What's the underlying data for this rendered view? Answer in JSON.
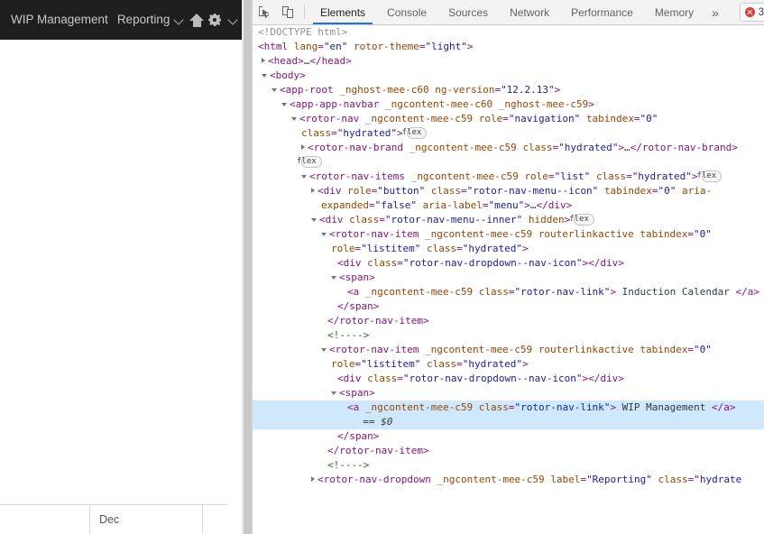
{
  "webpage": {
    "navbar": {
      "links": [
        {
          "label": "WIP Management",
          "name": "nav-link-wip-management"
        }
      ],
      "dropdown": {
        "label": "Reporting",
        "name": "nav-dropdown-reporting"
      },
      "icons": [
        {
          "name": "home-icon"
        },
        {
          "name": "gear-icon"
        },
        {
          "name": "chevron-down-icon"
        }
      ],
      "background": "#1e1e1e",
      "text_color": "#c9c9c9"
    },
    "bottom_table": {
      "cells": [
        "",
        "Dec",
        ""
      ]
    }
  },
  "devtools": {
    "toolbar": {
      "inspect_icon": "inspect-element-icon",
      "device_icon": "device-toolbar-icon",
      "tabs": [
        {
          "label": "Elements",
          "active": true
        },
        {
          "label": "Console",
          "active": false
        },
        {
          "label": "Sources",
          "active": false
        },
        {
          "label": "Network",
          "active": false
        },
        {
          "label": "Performance",
          "active": false
        },
        {
          "label": "Memory",
          "active": false
        }
      ],
      "more_label": "»",
      "error_count": "3",
      "accent_color": "#1a73e8",
      "error_color": "#e53935"
    },
    "dom_tree": {
      "lines": [
        {
          "indent": 0,
          "twisty": "none",
          "html": "<span class=\"doct\">&lt;!DOCTYPE html&gt;</span>"
        },
        {
          "indent": 0,
          "twisty": "none",
          "html": "<span class=\"punc\">&lt;</span><span class=\"tag\">html</span> <span class=\"attr\">lang</span><span class=\"punc\">=</span><span class=\"val\">\"en\"</span> <span class=\"attr\">rotor-theme</span><span class=\"punc\">=</span><span class=\"val\">\"light\"</span><span class=\"punc\">&gt;</span>"
        },
        {
          "indent": 1,
          "twisty": "closed",
          "html": "<span class=\"punc\">&lt;</span><span class=\"tag\">head</span><span class=\"punc\">&gt;</span><span class=\"txt\">…</span><span class=\"punc\">&lt;/</span><span class=\"tag\">head</span><span class=\"punc\">&gt;</span>"
        },
        {
          "indent": 1,
          "twisty": "open",
          "html": "<span class=\"punc\">&lt;</span><span class=\"tag\">body</span><span class=\"punc\">&gt;</span>"
        },
        {
          "indent": 2,
          "twisty": "open",
          "html": "<span class=\"punc\">&lt;</span><span class=\"tag\">app-root</span> <span class=\"attr\">_nghost-mee-c60</span> <span class=\"attr\">ng-version</span><span class=\"punc\">=</span><span class=\"val\">\"12.2.13\"</span><span class=\"punc\">&gt;</span>"
        },
        {
          "indent": 3,
          "twisty": "open",
          "html": "<span class=\"punc\">&lt;</span><span class=\"tag\">app-app-navbar</span> <span class=\"attr\">_ngcontent-mee-c60</span> <span class=\"attr\">_nghost-mee-c59</span><span class=\"punc\">&gt;</span>"
        },
        {
          "indent": 4,
          "twisty": "open",
          "html": "<span class=\"punc\">&lt;</span><span class=\"tag\">rotor-nav</span> <span class=\"attr\">_ngcontent-mee-c59</span> <span class=\"attr\">role</span><span class=\"punc\">=</span><span class=\"val\">\"navigation\"</span> <span class=\"attr\">tabindex</span><span class=\"punc\">=</span><span class=\"val\">\"0\"</span> <span class=\"attr\">class</span><span class=\"punc\">=</span><span class=\"val\">\"hydrated\"</span><span class=\"punc\">&gt;</span><span class=\"badge\">flex</span>"
        },
        {
          "indent": 5,
          "twisty": "closed",
          "html": "<span class=\"punc\">&lt;</span><span class=\"tag\">rotor-nav-brand</span> <span class=\"attr\">_ngcontent-mee-c59</span> <span class=\"attr\">class</span><span class=\"punc\">=</span><span class=\"val\">\"hydrated\"</span><span class=\"punc\">&gt;</span><span class=\"txt\">…</span><span class=\"punc\">&lt;/</span><span class=\"tag\">rotor-nav-brand</span><span class=\"punc\">&gt;</span>"
        },
        {
          "indent": 5,
          "twisty": "blank",
          "html": "<span class=\"badge\" style=\"margin-left:0\">flex</span>"
        },
        {
          "indent": 5,
          "twisty": "open",
          "html": "<span class=\"punc\">&lt;</span><span class=\"tag\">rotor-nav-items</span> <span class=\"attr\">_ngcontent-mee-c59</span> <span class=\"attr\">role</span><span class=\"punc\">=</span><span class=\"val\">\"list\"</span> <span class=\"attr\">class</span><span class=\"punc\">=</span><span class=\"val\">\"hydrated\"</span><span class=\"punc\">&gt;</span><span class=\"badge\">flex</span>"
        },
        {
          "indent": 6,
          "twisty": "closed",
          "html": "<span class=\"punc\">&lt;</span><span class=\"tag\">div</span> <span class=\"attr\">role</span><span class=\"punc\">=</span><span class=\"val\">\"button\"</span> <span class=\"attr\">class</span><span class=\"punc\">=</span><span class=\"val\">\"rotor-nav-menu--icon\"</span> <span class=\"attr\">tabindex</span><span class=\"punc\">=</span><span class=\"val\">\"0\"</span> <span class=\"attr\">aria-expanded</span><span class=\"punc\">=</span><span class=\"val\">\"false\"</span> <span class=\"attr\">aria-label</span><span class=\"punc\">=</span><span class=\"val\">\"menu\"</span><span class=\"punc\">&gt;</span><span class=\"txt\">…</span><span class=\"punc\">&lt;/</span><span class=\"tag\">div</span><span class=\"punc\">&gt;</span>"
        },
        {
          "indent": 6,
          "twisty": "open",
          "html": "<span class=\"punc\">&lt;</span><span class=\"tag\">div</span> <span class=\"attr\">class</span><span class=\"punc\">=</span><span class=\"val\">\"rotor-nav-menu--inner\"</span> <span class=\"attr\">hidden</span><span class=\"punc\">&gt;</span><span class=\"badge\">flex</span>"
        },
        {
          "indent": 7,
          "twisty": "open",
          "html": "<span class=\"punc\">&lt;</span><span class=\"tag\">rotor-nav-item</span> <span class=\"attr\">_ngcontent-mee-c59</span> <span class=\"attr\">routerlinkactive</span> <span class=\"attr\">tabindex</span><span class=\"punc\">=</span><span class=\"val\">\"0\"</span> <span class=\"attr\">role</span><span class=\"punc\">=</span><span class=\"val\">\"listitem\"</span> <span class=\"attr\">class</span><span class=\"punc\">=</span><span class=\"val\">\"hydrated\"</span><span class=\"punc\">&gt;</span>"
        },
        {
          "indent": 8,
          "twisty": "none",
          "html": "<span class=\"punc\">&lt;</span><span class=\"tag\">div</span> <span class=\"attr\">class</span><span class=\"punc\">=</span><span class=\"val\">\"rotor-nav-dropdown--nav-icon\"</span><span class=\"punc\">&gt;&lt;/</span><span class=\"tag\">div</span><span class=\"punc\">&gt;</span>"
        },
        {
          "indent": 8,
          "twisty": "open",
          "html": "<span class=\"punc\">&lt;</span><span class=\"tag\">span</span><span class=\"punc\">&gt;</span>"
        },
        {
          "indent": 9,
          "twisty": "none",
          "html": "<span class=\"punc\">&lt;</span><span class=\"tag\">a</span> <span class=\"attr\">_ngcontent-mee-c59</span> <span class=\"attr\">class</span><span class=\"punc\">=</span><span class=\"val\">\"rotor-nav-link\"</span><span class=\"punc\">&gt;</span><span class=\"txt\"> Induction Calendar </span><span class=\"punc\">&lt;/</span><span class=\"tag\">a</span><span class=\"punc\">&gt;</span>"
        },
        {
          "indent": 8,
          "twisty": "none",
          "html": "<span class=\"punc\">&lt;/</span><span class=\"tag\">span</span><span class=\"punc\">&gt;</span>"
        },
        {
          "indent": 7,
          "twisty": "none",
          "html": "<span class=\"punc\">&lt;/</span><span class=\"tag\">rotor-nav-item</span><span class=\"punc\">&gt;</span>"
        },
        {
          "indent": 7,
          "twisty": "none",
          "html": "<span class=\"cmt\">&lt;!----&gt;</span>"
        },
        {
          "indent": 7,
          "twisty": "open",
          "html": "<span class=\"punc\">&lt;</span><span class=\"tag\">rotor-nav-item</span> <span class=\"attr\">_ngcontent-mee-c59</span> <span class=\"attr\">routerlinkactive</span> <span class=\"attr\">tabindex</span><span class=\"punc\">=</span><span class=\"val\">\"0\"</span> <span class=\"attr\">role</span><span class=\"punc\">=</span><span class=\"val\">\"listitem\"</span> <span class=\"attr\">class</span><span class=\"punc\">=</span><span class=\"val\">\"hydrated\"</span><span class=\"punc\">&gt;</span>"
        },
        {
          "indent": 8,
          "twisty": "none",
          "html": "<span class=\"punc\">&lt;</span><span class=\"tag\">div</span> <span class=\"attr\">class</span><span class=\"punc\">=</span><span class=\"val\">\"rotor-nav-dropdown--nav-icon\"</span><span class=\"punc\">&gt;&lt;/</span><span class=\"tag\">div</span><span class=\"punc\">&gt;</span>"
        },
        {
          "indent": 8,
          "twisty": "open",
          "html": "<span class=\"punc\">&lt;</span><span class=\"tag\">span</span><span class=\"punc\">&gt;</span>"
        },
        {
          "indent": 9,
          "twisty": "none",
          "selected": true,
          "html": "<span class=\"punc\">&lt;</span><span class=\"tag\">a</span> <span class=\"attr\">_ngcontent-mee-c59</span> <span class=\"attr\">class</span><span class=\"punc\">=</span><span class=\"val\">\"rotor-nav-link\"</span><span class=\"punc\">&gt;</span><span class=\"txt\"> WIP Management </span><span class=\"punc\">&lt;/</span><span class=\"tag\">a</span><span class=\"punc\">&gt;</span>\n  <span class=\"eq0\">== $0</span>"
        },
        {
          "indent": 8,
          "twisty": "none",
          "html": "<span class=\"punc\">&lt;/</span><span class=\"tag\">span</span><span class=\"punc\">&gt;</span>"
        },
        {
          "indent": 7,
          "twisty": "none",
          "html": "<span class=\"punc\">&lt;/</span><span class=\"tag\">rotor-nav-item</span><span class=\"punc\">&gt;</span>"
        },
        {
          "indent": 7,
          "twisty": "none",
          "html": "<span class=\"cmt\">&lt;!----&gt;</span>"
        },
        {
          "indent": 6,
          "twisty": "closed",
          "html": "<span class=\"punc\">&lt;</span><span class=\"tag\">rotor-nav-dropdown</span> <span class=\"attr\">_ngcontent-mee-c59</span> <span class=\"attr\">label</span><span class=\"punc\">=</span><span class=\"val\">\"Reporting\"</span> <span class=\"attr\">class</span><span class=\"punc\">=</span><span class=\"val\">\"hydrate</span>"
        }
      ]
    }
  }
}
